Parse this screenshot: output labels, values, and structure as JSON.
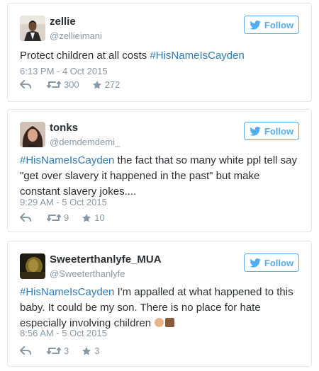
{
  "tweets": [
    {
      "name": "zellie",
      "handle": "@zellieimani",
      "follow_label": "Follow",
      "text_plain": "Protect children at all costs ",
      "hashtag": "#HisNameIsCayden",
      "text_after": "",
      "timestamp": "6:13 PM - 4 Oct 2015",
      "retweets": "300",
      "likes": "272"
    },
    {
      "name": "tonks",
      "handle": "@demdemdemi_",
      "follow_label": "Follow",
      "hashtag": "#HisNameIsCayden",
      "text_after": " the fact that so many white ppl tell say \"get over slavery it happened in the past\" but make constant slavery jokes....",
      "timestamp": "9:29 AM - 5 Oct 2015",
      "retweets": "9",
      "likes": "10"
    },
    {
      "name": "Sweeterthanlyfe_MUA",
      "handle": "@Sweeterthanlyfe",
      "follow_label": "Follow",
      "hashtag": "#HisNameIsCayden",
      "text_after": " I'm appalled at what happened to this baby. It could be my son. There is no place for hate especially involving children",
      "timestamp": "8:56 AM - 5 Oct 2015",
      "retweets": "3",
      "likes": "3"
    }
  ],
  "colors": {
    "accent": "#55acee",
    "hashtag": "#2b7bb9",
    "muted": "#8899a6",
    "border": "#e1e8ed"
  },
  "icons": [
    "twitter-bird-icon",
    "reply-icon",
    "retweet-icon",
    "like-star-icon",
    "clapping-hands-emoji",
    "brown-square-emoji"
  ]
}
